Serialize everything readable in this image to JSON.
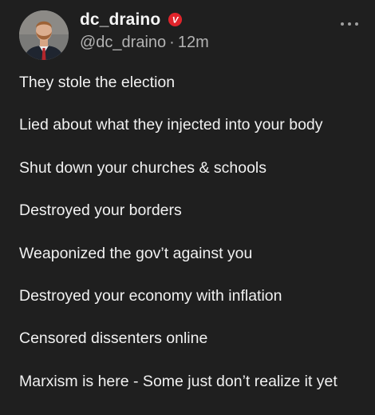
{
  "author": {
    "username": "dc_draino",
    "handle": "@dc_draino",
    "time": "12m",
    "separator": "·",
    "verified_badge_letter": "V"
  },
  "post": {
    "lines": [
      "They stole the election",
      "Lied about what they injected into your body",
      "Shut down your churches & schools",
      "Destroyed your borders",
      "Weaponized the gov’t against you",
      "Destroyed your economy with inflation",
      "Censored dissenters online",
      "Marxism is here - Some just don’t realize it yet"
    ]
  },
  "icons": {
    "menu": "more-horizontal-icon",
    "badge": "verified-badge-icon"
  },
  "colors": {
    "background": "#1f1f1f",
    "text": "#f1f1f1",
    "muted": "#b3b3b3",
    "badge": "#e0242b"
  }
}
